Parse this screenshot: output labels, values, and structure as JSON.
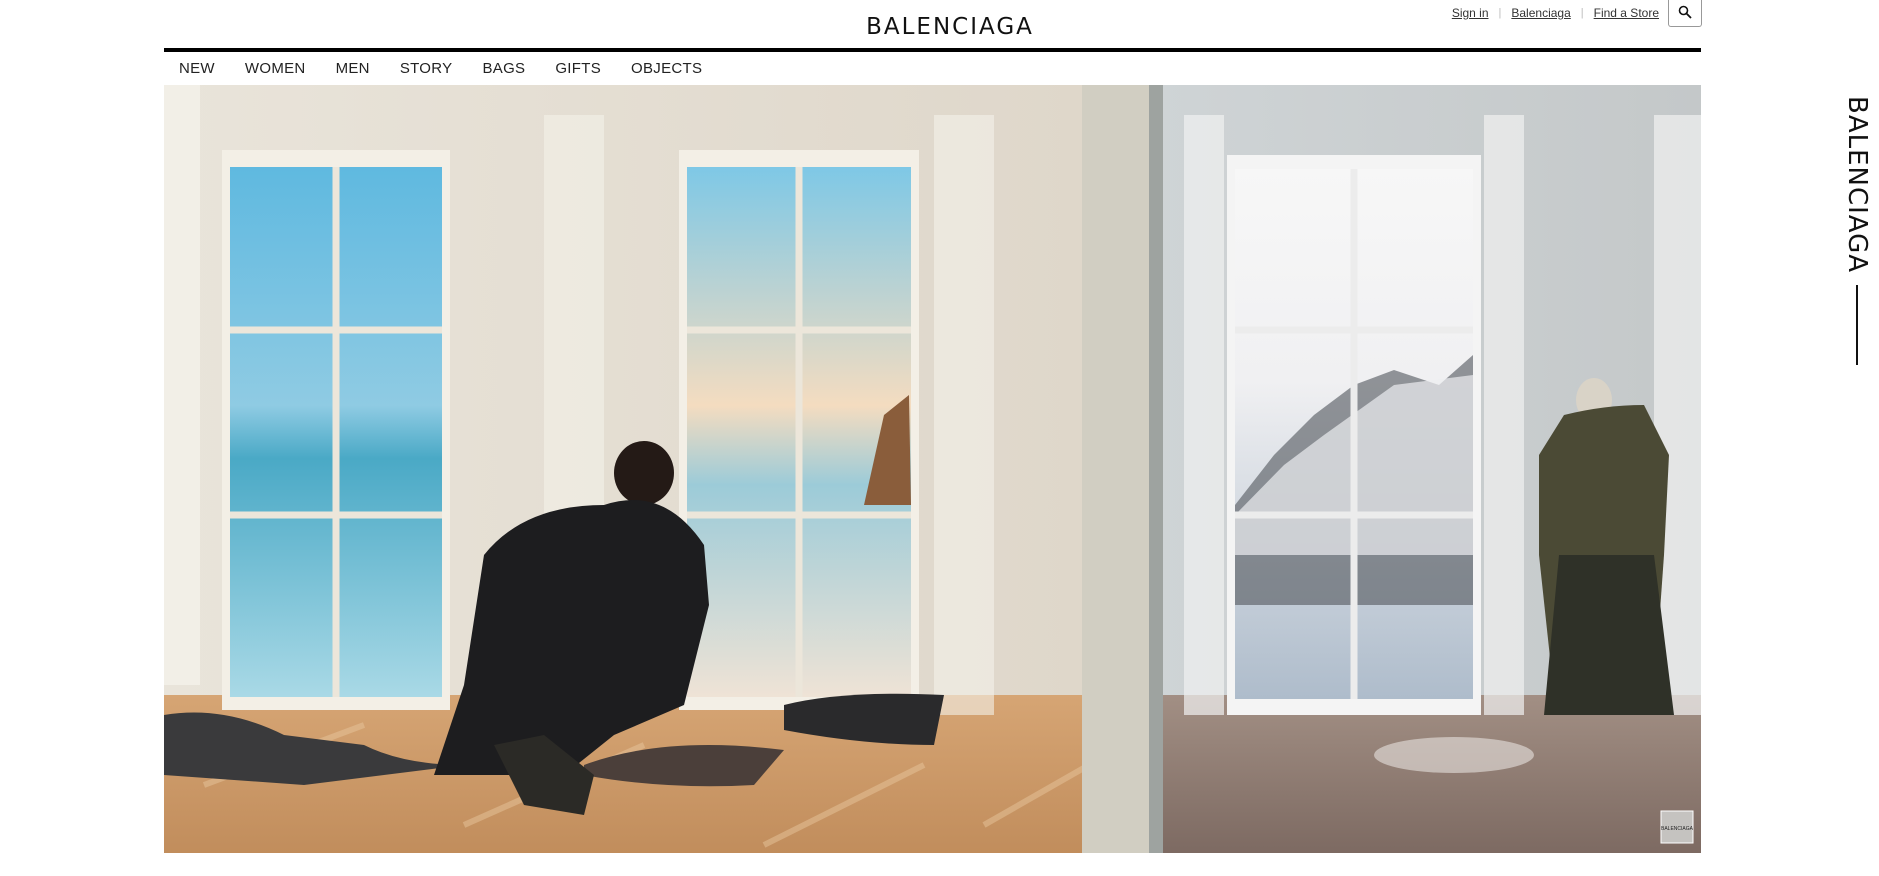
{
  "header": {
    "logo": "BALENCIAGA",
    "utility_links": [
      "Sign in",
      "Balenciaga",
      "Find a Store"
    ],
    "search_icon": "search-icon"
  },
  "nav": {
    "items": [
      "NEW",
      "WOMEN",
      "MEN",
      "STORY",
      "BAGS",
      "GIFTS",
      "OBJECTS"
    ]
  },
  "hero": {
    "badge_text": "BALENCIAGA"
  },
  "side_brand": {
    "text": "BALENCIAGA"
  },
  "colors": {
    "rule": "#000000",
    "text": "#111111",
    "link": "#333333"
  }
}
